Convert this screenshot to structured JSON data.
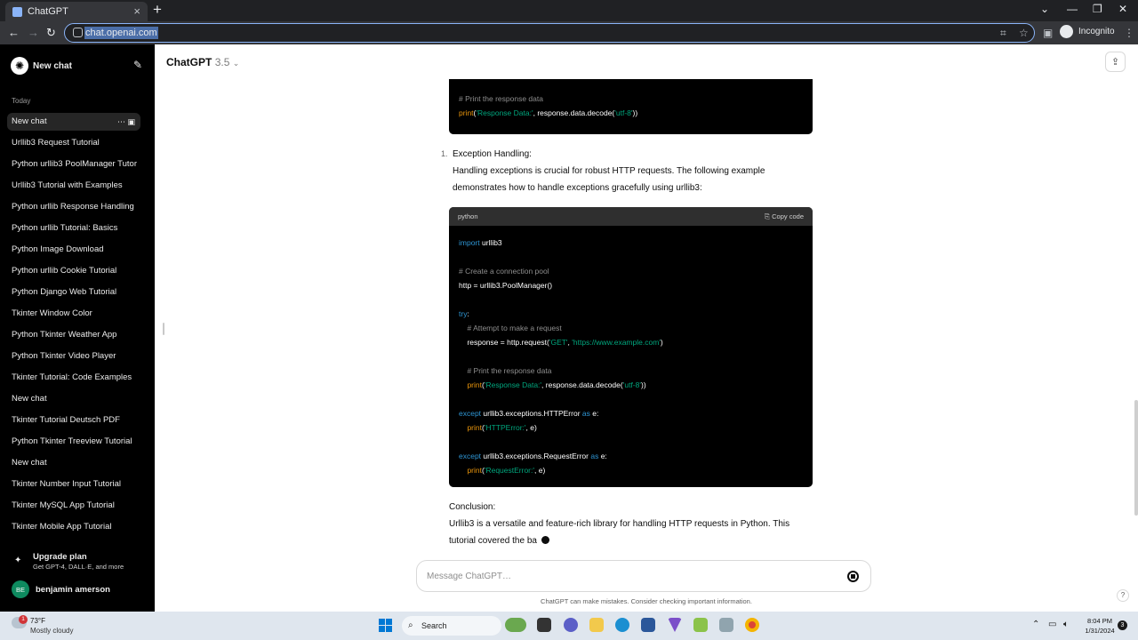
{
  "browser": {
    "tab_title": "ChatGPT",
    "url": "chat.openai.com",
    "incognito_label": "Incognito"
  },
  "sidebar": {
    "new_chat_label": "New chat",
    "section_today": "Today",
    "items": [
      {
        "label": "New chat",
        "active": true
      },
      {
        "label": "Urllib3 Request Tutorial"
      },
      {
        "label": "Python urllib3 PoolManager Tutor"
      },
      {
        "label": "Urllib3 Tutorial with Examples"
      },
      {
        "label": "Python urllib Response Handling"
      },
      {
        "label": "Python urllib Tutorial: Basics"
      },
      {
        "label": "Python Image Download"
      },
      {
        "label": "Python urllib Cookie Tutorial"
      },
      {
        "label": "Python Django Web Tutorial"
      },
      {
        "label": "Tkinter Window Color"
      },
      {
        "label": "Python Tkinter Weather App"
      },
      {
        "label": "Python Tkinter Video Player"
      },
      {
        "label": "Tkinter Tutorial: Code Examples"
      },
      {
        "label": "New chat"
      },
      {
        "label": "Tkinter Tutorial Deutsch PDF"
      },
      {
        "label": "Python Tkinter Treeview Tutorial"
      },
      {
        "label": "New chat"
      },
      {
        "label": "Tkinter Number Input Tutorial"
      },
      {
        "label": "Tkinter MySQL App Tutorial"
      },
      {
        "label": "Tkinter Mobile App Tutorial"
      }
    ],
    "upgrade_title": "Upgrade plan",
    "upgrade_subtitle": "Get GPT-4, DALL·E, and more",
    "user_initials": "BE",
    "user_name": "benjamin amerson"
  },
  "header": {
    "model_name": "ChatGPT",
    "model_version": "3.5"
  },
  "content": {
    "code_block_1": {
      "lines": [
        "# Print the response data",
        "print('Response Data:', response.data.decode('utf-8'))"
      ]
    },
    "list_number": "1.",
    "section_title": "Exception Handling:",
    "paragraph_line1": "Handling exceptions is crucial for robust HTTP requests. The following example",
    "paragraph_line2": "demonstrates how to handle exceptions gracefully using urllib3:",
    "code_block_2": {
      "language": "python",
      "copy_label": "Copy code",
      "lines": [
        "import urllib3",
        "# Create a connection pool",
        "http = urllib3.PoolManager()",
        "try:",
        "    # Attempt to make a request",
        "    response = http.request('GET', 'https://www.example.com')",
        "    # Print the response data",
        "    print('Response Data:', response.data.decode('utf-8'))",
        "except urllib3.exceptions.HTTPError as e:",
        "    print('HTTPError:', e)",
        "except urllib3.exceptions.RequestError as e:",
        "    print('RequestError:', e)"
      ]
    },
    "conclusion_title": "Conclusion:",
    "conclusion_line1": "Urllib3 is a versatile and feature-rich library for handling HTTP requests in Python. This",
    "conclusion_line2": "tutorial covered the ba"
  },
  "composer": {
    "placeholder": "Message ChatGPT…",
    "disclaimer": "ChatGPT can make mistakes. Consider checking important information."
  },
  "taskbar": {
    "temperature": "73°F",
    "condition": "Mostly cloudy",
    "weather_badge": "1",
    "search_label": "Search",
    "time": "8:04 PM",
    "date": "1/31/2024",
    "notification_count": "3"
  },
  "colors": {
    "sidebar_bg": "#000000",
    "code_bg": "#000000",
    "keyword": "#2e95d3",
    "string": "#00a67d",
    "comment": "#8e8e8e"
  }
}
